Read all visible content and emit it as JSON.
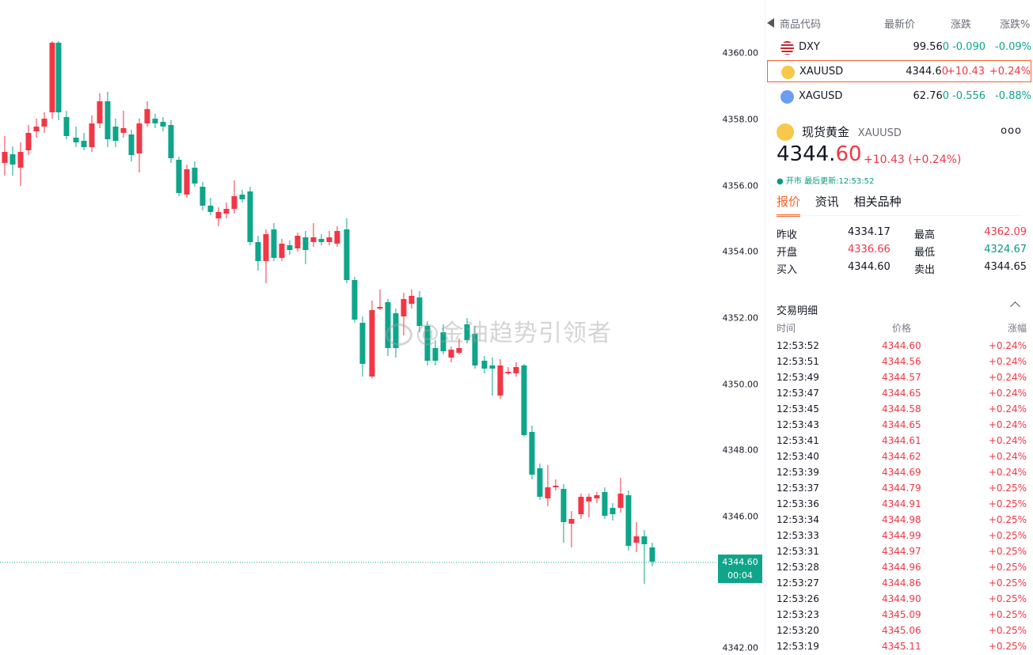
{
  "chart": {
    "y_ticks": [
      "4360.00",
      "4358.00",
      "4356.00",
      "4354.00",
      "4352.00",
      "4350.00",
      "4348.00",
      "4346.00",
      "4342.00"
    ],
    "last_price_tag": "4344.60",
    "countdown": "00:04",
    "watermark": "@金油趋势引领者",
    "colors": {
      "up": "#f23645",
      "down": "#0ea58a"
    }
  },
  "watchlist": {
    "headers": {
      "symbol": "商品代码",
      "last": "最新价",
      "change": "涨跌",
      "change_pct": "涨跌%"
    },
    "rows": [
      {
        "symbol": "DXY",
        "last_main": "99.56",
        "last_tail": "0",
        "change": "-0.090",
        "change_pct": "-0.09%",
        "dir": "down",
        "icon": "us-flag-icon"
      },
      {
        "symbol": "XAUUSD",
        "last_main": "4344.6",
        "last_tail": "0",
        "change": "+10.43",
        "change_pct": "+0.24%",
        "dir": "up",
        "icon": "gold-icon"
      },
      {
        "symbol": "XAGUSD",
        "last_main": "62.76",
        "last_tail": "0",
        "change": "-0.556",
        "change_pct": "-0.88%",
        "dir": "down",
        "icon": "silver-icon"
      }
    ]
  },
  "detail": {
    "name": "现货黄金",
    "symbol": "XAUUSD",
    "price_main": "4344.",
    "price_tail": "60",
    "change": "+10.43 (+0.24%)",
    "status": "● 开市  最后更新:12:53:52",
    "more": "ooo",
    "tabs": [
      "报价",
      "资讯",
      "相关品种"
    ],
    "stats": [
      {
        "label": "昨收",
        "value": "4334.17",
        "label2": "最高",
        "value2": "4362.09"
      },
      {
        "label": "开盘",
        "value": "4336.66",
        "label2": "最低",
        "value2": "4324.67"
      },
      {
        "label": "买入",
        "value": "4344.60",
        "label2": "卖出",
        "value2": "4344.65"
      }
    ]
  },
  "trades": {
    "title": "交易明细",
    "headers": {
      "time": "时间",
      "price": "价格",
      "change": "涨幅"
    },
    "rows": [
      {
        "time": "12:53:52",
        "price": "4344.60",
        "change": "+0.24%"
      },
      {
        "time": "12:53:51",
        "price": "4344.56",
        "change": "+0.24%"
      },
      {
        "time": "12:53:49",
        "price": "4344.57",
        "change": "+0.24%"
      },
      {
        "time": "12:53:47",
        "price": "4344.65",
        "change": "+0.24%"
      },
      {
        "time": "12:53:45",
        "price": "4344.58",
        "change": "+0.24%"
      },
      {
        "time": "12:53:43",
        "price": "4344.65",
        "change": "+0.24%"
      },
      {
        "time": "12:53:41",
        "price": "4344.61",
        "change": "+0.24%"
      },
      {
        "time": "12:53:40",
        "price": "4344.62",
        "change": "+0.24%"
      },
      {
        "time": "12:53:39",
        "price": "4344.69",
        "change": "+0.24%"
      },
      {
        "time": "12:53:37",
        "price": "4344.79",
        "change": "+0.25%"
      },
      {
        "time": "12:53:36",
        "price": "4344.91",
        "change": "+0.25%"
      },
      {
        "time": "12:53:34",
        "price": "4344.98",
        "change": "+0.25%"
      },
      {
        "time": "12:53:33",
        "price": "4344.99",
        "change": "+0.25%"
      },
      {
        "time": "12:53:31",
        "price": "4344.97",
        "change": "+0.25%"
      },
      {
        "time": "12:53:28",
        "price": "4344.96",
        "change": "+0.25%"
      },
      {
        "time": "12:53:27",
        "price": "4344.86",
        "change": "+0.25%"
      },
      {
        "time": "12:53:26",
        "price": "4344.90",
        "change": "+0.25%"
      },
      {
        "time": "12:53:23",
        "price": "4345.09",
        "change": "+0.25%"
      },
      {
        "time": "12:53:20",
        "price": "4345.06",
        "change": "+0.25%"
      },
      {
        "time": "12:53:19",
        "price": "4345.11",
        "change": "+0.25%"
      }
    ]
  }
}
